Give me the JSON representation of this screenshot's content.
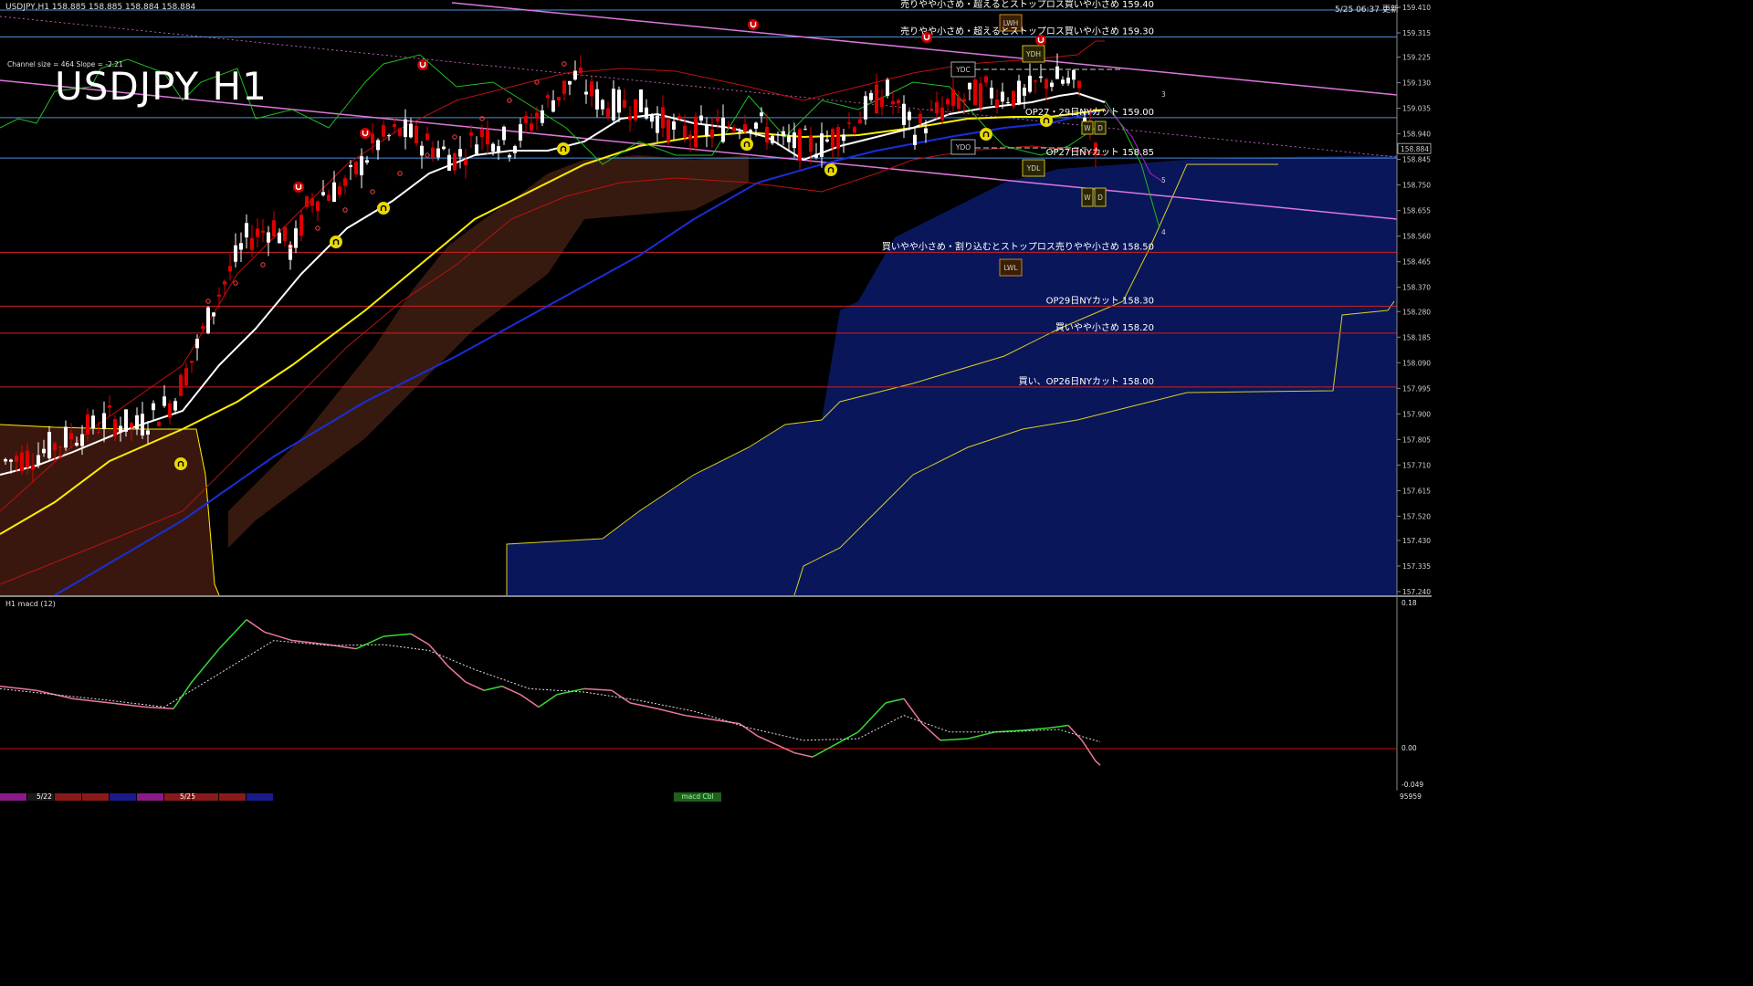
{
  "header": {
    "symbol_info": "USDJPY,H1  158.885 158.885 158.884 158.884",
    "channel_info": "Channel size = 464 Slope = -2.21",
    "title": "USDJPY H1",
    "timestamp": "5/25 06:37 更新"
  },
  "price_axis": {
    "labels": [
      "159.410",
      "159.315",
      "159.225",
      "159.130",
      "159.035",
      "158.940",
      "158.845",
      "158.750",
      "158.655",
      "158.560",
      "158.465",
      "158.370",
      "158.280",
      "158.185",
      "158.090",
      "157.995",
      "157.900",
      "157.805",
      "157.710",
      "157.615",
      "157.520",
      "157.430",
      "157.335",
      "157.240"
    ],
    "current_price": "158.884",
    "current_color": "#ffffff"
  },
  "levels": [
    {
      "text": "売りやや小さめ・超えるとストップロス買いや小さめ 159.40",
      "price": 159.4,
      "color": "#4a8fd8"
    },
    {
      "text": "売りやや小さめ・超えるとストップロス買いや小さめ 159.30",
      "price": 159.3,
      "color": "#4a8fd8"
    },
    {
      "text": "OP27・29日NYカット 159.00",
      "price": 159.0,
      "color": "#4a8fd8"
    },
    {
      "text": "OP27日NYカット 158.85",
      "price": 158.85,
      "color": "#4a8fd8"
    },
    {
      "text": "買いやや小さめ・割り込むとストップロス売りやや小さめ 158.50",
      "price": 158.5,
      "color": "#cc2222"
    },
    {
      "text": "OP29日NYカット 158.30",
      "price": 158.3,
      "color": "#cc2222"
    },
    {
      "text": "買いやや小さめ 158.20",
      "price": 158.2,
      "color": "#cc2222"
    },
    {
      "text": "買い、OP26日NYカット 158.00",
      "price": 158.0,
      "color": "#cc2222"
    }
  ],
  "box_labels": {
    "lwh": "LWH",
    "ydh": "YDH",
    "ydc": "YDC",
    "ydo": "YDO",
    "ydl": "YDL",
    "lwl": "LWL",
    "w": "W",
    "d": "D"
  },
  "wave_labels": [
    "3",
    "5",
    "4"
  ],
  "macd": {
    "label": "H1  macd (12)",
    "axis": [
      "0.18",
      "0.00",
      "-0.049"
    ],
    "footer": "95959"
  },
  "bottom_bar": {
    "date1": "5/22",
    "date2": "5/25",
    "center": "macd Cbl",
    "colors": [
      "#8a1a8a",
      "#1a1a1a",
      "#8a1a1a",
      "#8a1a1a",
      "#1a1a8a",
      "#8a1a8a",
      "#8a1a1a",
      "#8a1a1a",
      "#8a1a1a",
      "#1a1a8a"
    ]
  },
  "colors": {
    "bull": "#ffffff",
    "bear": "#dd0000",
    "ma_white": "#ffffff",
    "ma_yellow": "#ffee00",
    "ma_blue": "#1a2ed8",
    "chikou": "#22bb22",
    "kumo_bull": "#1b2fa8",
    "kumo_bear": "#b0503a",
    "channel": "#dd77dd",
    "macd_up": "#33dd33",
    "macd_down": "#ee7799",
    "macd_signal": "#dddddd"
  },
  "chart_data": {
    "type": "line",
    "title": "USDJPY H1",
    "xlabel": "",
    "ylabel": "",
    "ylim": [
      157.24,
      159.41
    ],
    "x": [
      "5/22",
      "5/25"
    ],
    "series": [
      {
        "name": "",
        "values": [
          157.72,
          157.8,
          157.9,
          158.05,
          158.35,
          158.6,
          158.8,
          158.95,
          159.05,
          159.1,
          158.9,
          158.95,
          159.1,
          159.05,
          158.95,
          158.9,
          158.85,
          158.95,
          159.05,
          159.1,
          159.05,
          158.95,
          158.88
        ]
      }
    ]
  }
}
